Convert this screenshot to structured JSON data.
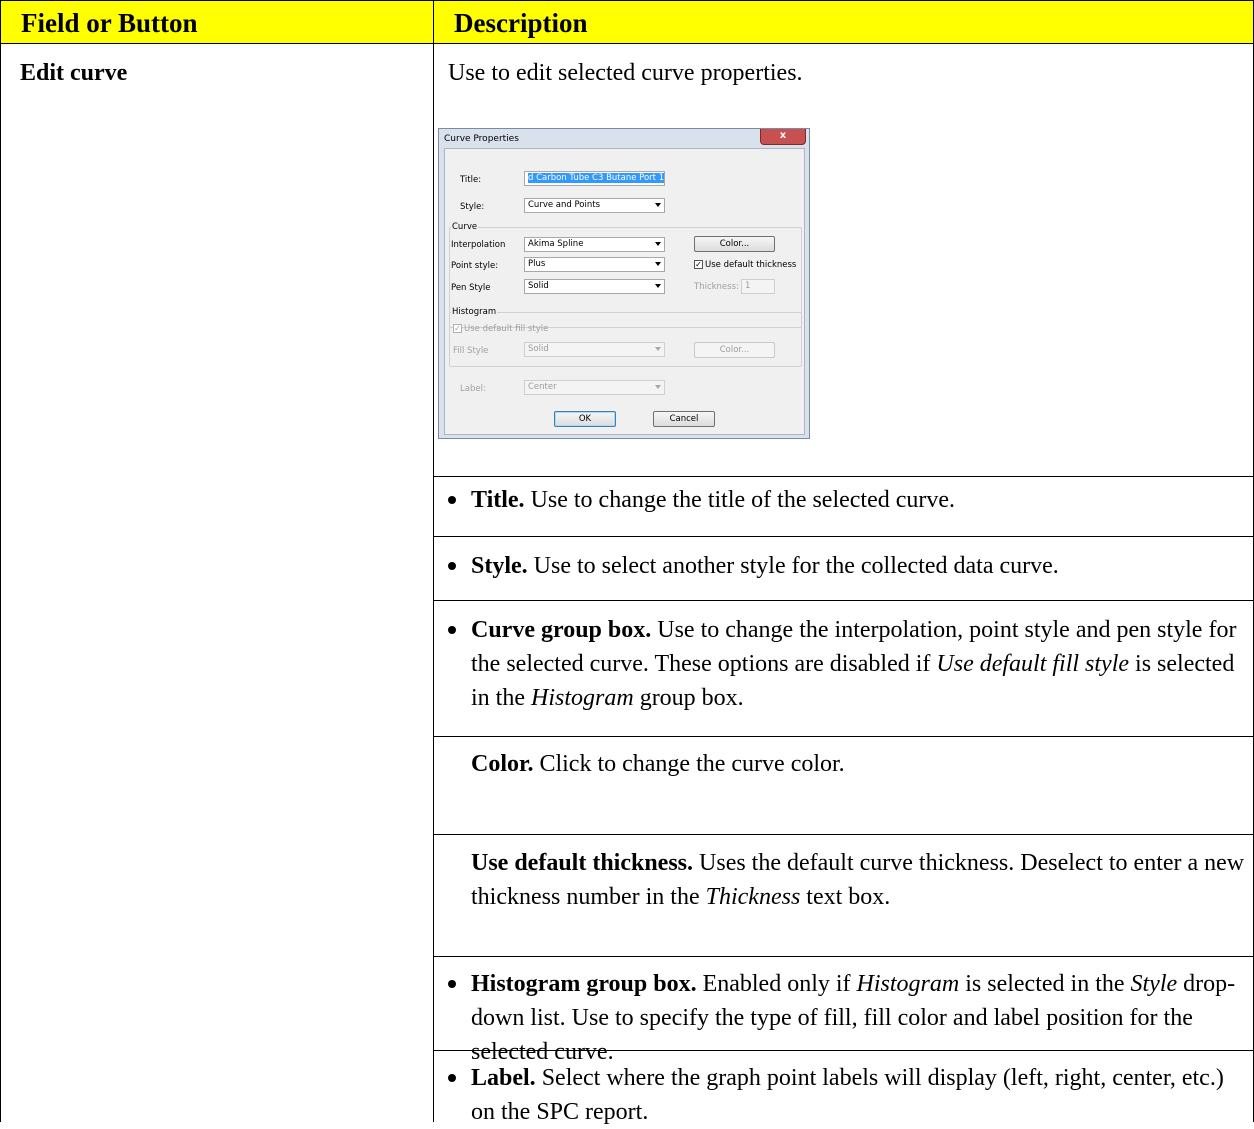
{
  "header": {
    "col1": "Field or Button",
    "col2": "Description"
  },
  "row": {
    "field": "Edit curve",
    "intro": "Use to edit selected curve properties."
  },
  "dialog": {
    "title": "Curve Properties",
    "close": "x",
    "title_label": "Title:",
    "title_value": "d Carbon Tube C3 Butane Port 1",
    "style_label": "Style:",
    "style_value": "Curve and Points",
    "curve_group": "Curve",
    "interp_label": "Interpolation",
    "interp_value": "Akima Spline",
    "point_label": "Point style:",
    "point_value": "Plus",
    "pen_label": "Pen Style",
    "pen_value": "Solid",
    "color_button": "Color...",
    "default_thickness": "Use default thickness",
    "thickness_label": "Thickness:",
    "thickness_value": "1",
    "hist_group": "Histogram",
    "default_fill": "Use default fill style",
    "fill_label": "Fill Style",
    "fill_value": "Solid",
    "hist_color_button": "Color...",
    "label_label": "Label:",
    "label_value": "Center",
    "ok": "OK",
    "cancel": "Cancel",
    "check_mark": "✓"
  },
  "bullets": {
    "title_b": "Title.",
    "title_t": " Use to change the title of the selected curve.",
    "style_b": "Style.",
    "style_t": " Use to select another style for the collected data curve.",
    "curve_b": "Curve group box.",
    "curve_t1": " Use to change the interpolation, point style and pen style for the selected curve. These options are disabled if ",
    "curve_i1": "Use default fill style",
    "curve_t2": " is selected in the ",
    "curve_i2": "Histogram",
    "curve_t3": " group box.",
    "color_b": "Color.",
    "color_t": " Click to change the curve color.",
    "thick_b": "Use default thickness.",
    "thick_t1": " Uses the default curve thickness. Deselect to enter a new thickness number in the ",
    "thick_i": "Thickness",
    "thick_t2": " text box.",
    "hist_b": "Histogram group box.",
    "hist_t1": " Enabled only if ",
    "hist_i1": "Histogram",
    "hist_t2": " is selected in the ",
    "hist_i2": "Style",
    "hist_t3": " drop-down list. Use to specify the type of fill, fill color and label position for the selected curve.",
    "label_b": "Label.",
    "label_t": " Select where the graph point labels will display (left, right, center, etc.) on the SPC report."
  }
}
